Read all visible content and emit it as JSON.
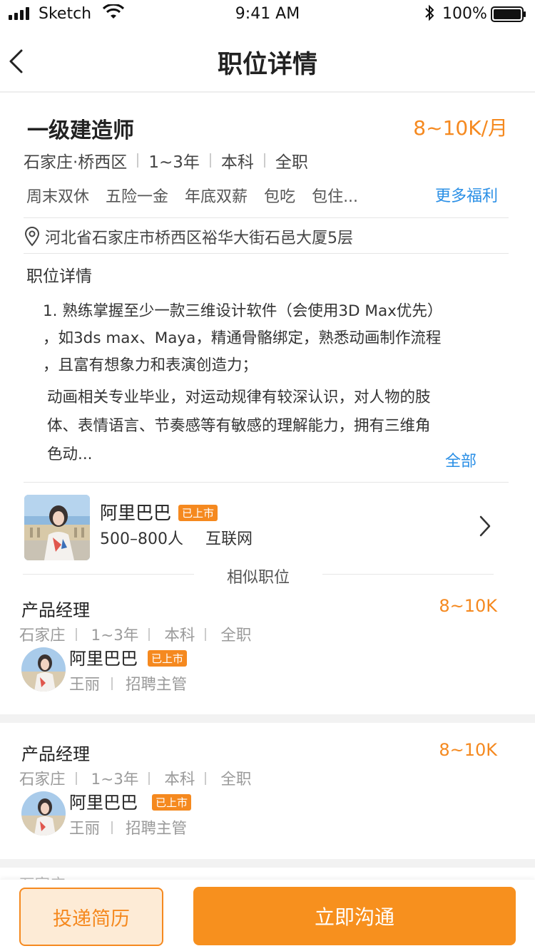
{
  "status_bar": {
    "carrier": "Sketch",
    "time": "9:41 AM",
    "battery": "100%"
  },
  "nav": {
    "title": "职位详情"
  },
  "job": {
    "title": "一级建造师",
    "salary": "8~10K/月",
    "location": "石家庄·桥西区",
    "experience": "1~3年",
    "education": "本科",
    "type": "全职",
    "benefits": [
      "周末双休",
      "五险一金",
      "年底双薪",
      "包吃",
      "包住..."
    ],
    "more_benefits": "更多福利",
    "address": "河北省石家庄市桥西区裕华大街石邑大厦5层"
  },
  "description": {
    "heading": "职位详情",
    "lines_p1": [
      "1. 熟练掌握至少一款三维设计软件（会使用3D Max优先）",
      "，如3ds max、Maya，精通骨骼绑定，熟悉动画制作流程",
      "，且富有想象力和表演创造力；"
    ],
    "lines_p2": [
      "动画相关专业毕业，对运动规律有较深认识，对人物的肢",
      "体、表情语言、节奏感等有敏感的理解能力，拥有三维角",
      "色动..."
    ],
    "all_link": "全部"
  },
  "company": {
    "name": "阿里巴巴",
    "badge": "已上市",
    "size": "500–800人",
    "industry": "互联网"
  },
  "similar": {
    "heading": "相似职位",
    "items": [
      {
        "title": "产品经理",
        "salary": "8~10K",
        "location": "石家庄",
        "experience": "1~3年",
        "education": "本科",
        "type": "全职",
        "company": "阿里巴巴",
        "badge": "已上市",
        "recruiter": "王丽",
        "role": "招聘主管"
      },
      {
        "title": "产品经理",
        "salary": "8~10K",
        "location": "石家庄",
        "experience": "1~3年",
        "education": "本科",
        "type": "全职",
        "company": "阿里巴巴",
        "badge": "已上市",
        "recruiter": "王丽",
        "role": "招聘主管"
      }
    ]
  },
  "actions": {
    "resume": "投递简历",
    "chat": "立即沟通"
  },
  "colors": {
    "accent": "#f5891f",
    "link": "#2a8fe6"
  }
}
